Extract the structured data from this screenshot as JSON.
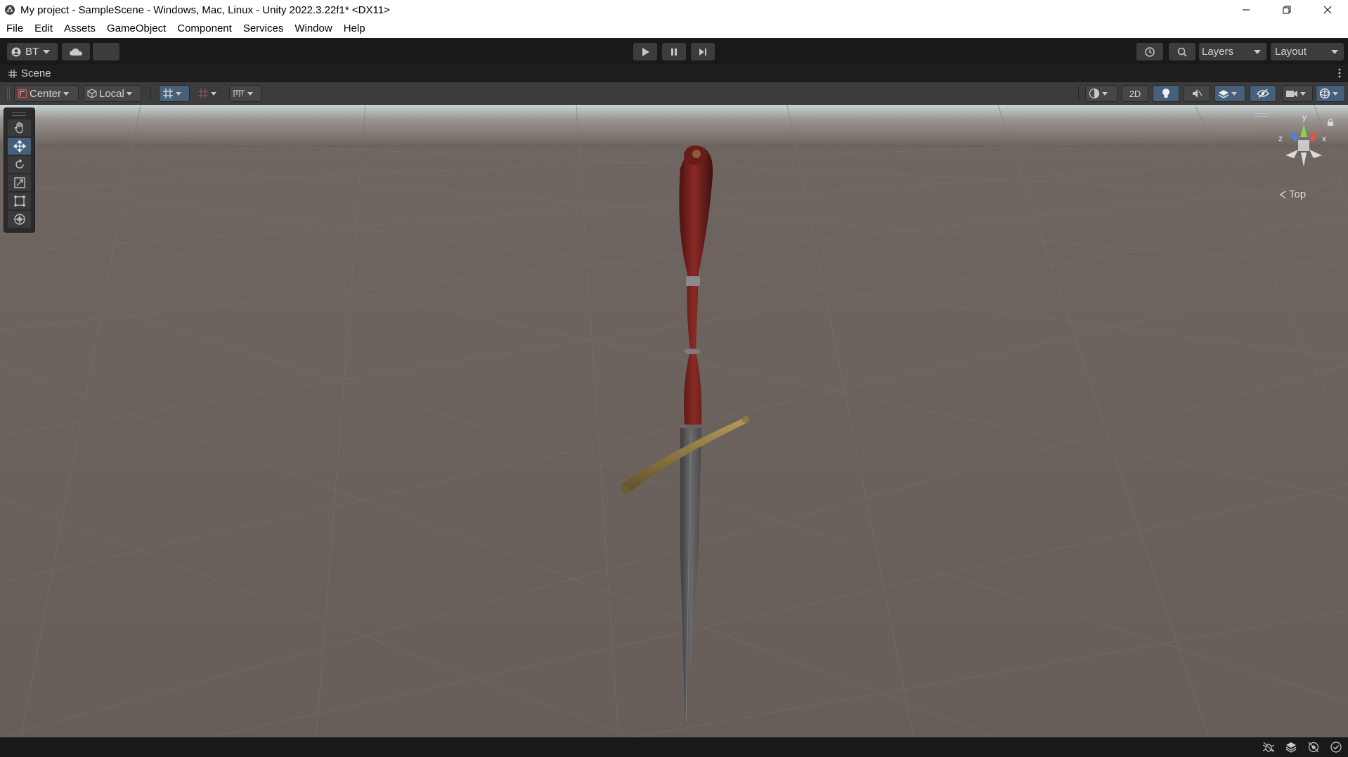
{
  "window": {
    "title": "My project - SampleScene - Windows, Mac, Linux - Unity 2022.3.22f1* <DX11>"
  },
  "menu": {
    "items": [
      "File",
      "Edit",
      "Assets",
      "GameObject",
      "Component",
      "Services",
      "Window",
      "Help"
    ]
  },
  "toolbar": {
    "account_label": "BT",
    "layers_label": "Layers",
    "layout_label": "Layout"
  },
  "scene_tab": {
    "label": "Scene"
  },
  "scene_toolbar": {
    "pivot_label": "Center",
    "space_label": "Local",
    "mode_2d_label": "2D"
  },
  "gizmo": {
    "view_label": "Top",
    "axis_x": "x",
    "axis_y": "y",
    "axis_z": "z"
  },
  "colors": {
    "ground": "#6a605b",
    "sky": "#c8d4d4",
    "grip": "#7a1f1c",
    "crossguard": "#8c7840",
    "blade": "#5a5a5a",
    "active_tool": "#46607c"
  }
}
